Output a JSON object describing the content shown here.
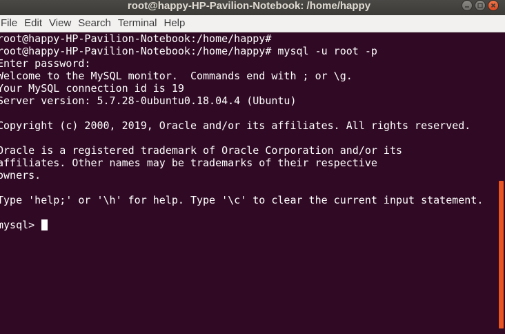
{
  "window": {
    "title": "root@happy-HP-Pavilion-Notebook: /home/happy",
    "controls": [
      "minimize-icon",
      "maximize-icon",
      "close-icon"
    ]
  },
  "menu": {
    "items": [
      {
        "label": "File"
      },
      {
        "label": "Edit"
      },
      {
        "label": "View"
      },
      {
        "label": "Search"
      },
      {
        "label": "Terminal"
      },
      {
        "label": "Help"
      }
    ]
  },
  "terminal": {
    "lines": [
      "root@happy-HP-Pavilion-Notebook:/home/happy#",
      "root@happy-HP-Pavilion-Notebook:/home/happy# mysql -u root -p",
      "Enter password:",
      "Welcome to the MySQL monitor.  Commands end with ; or \\g.",
      "Your MySQL connection id is 19",
      "Server version: 5.7.28-0ubuntu0.18.04.4 (Ubuntu)",
      "",
      "Copyright (c) 2000, 2019, Oracle and/or its affiliates. All rights reserved.",
      "",
      "Oracle is a registered trademark of Oracle Corporation and/or its",
      "affiliates. Other names may be trademarks of their respective",
      "owners.",
      "",
      "Type 'help;' or '\\h' for help. Type '\\c' to clear the current input statement.",
      "",
      "mysql> "
    ]
  },
  "colors": {
    "terminal_background": "#300a24",
    "terminal_text": "#ffffff",
    "scrollbar_thumb": "#e95420",
    "close_button": "#e95420"
  }
}
